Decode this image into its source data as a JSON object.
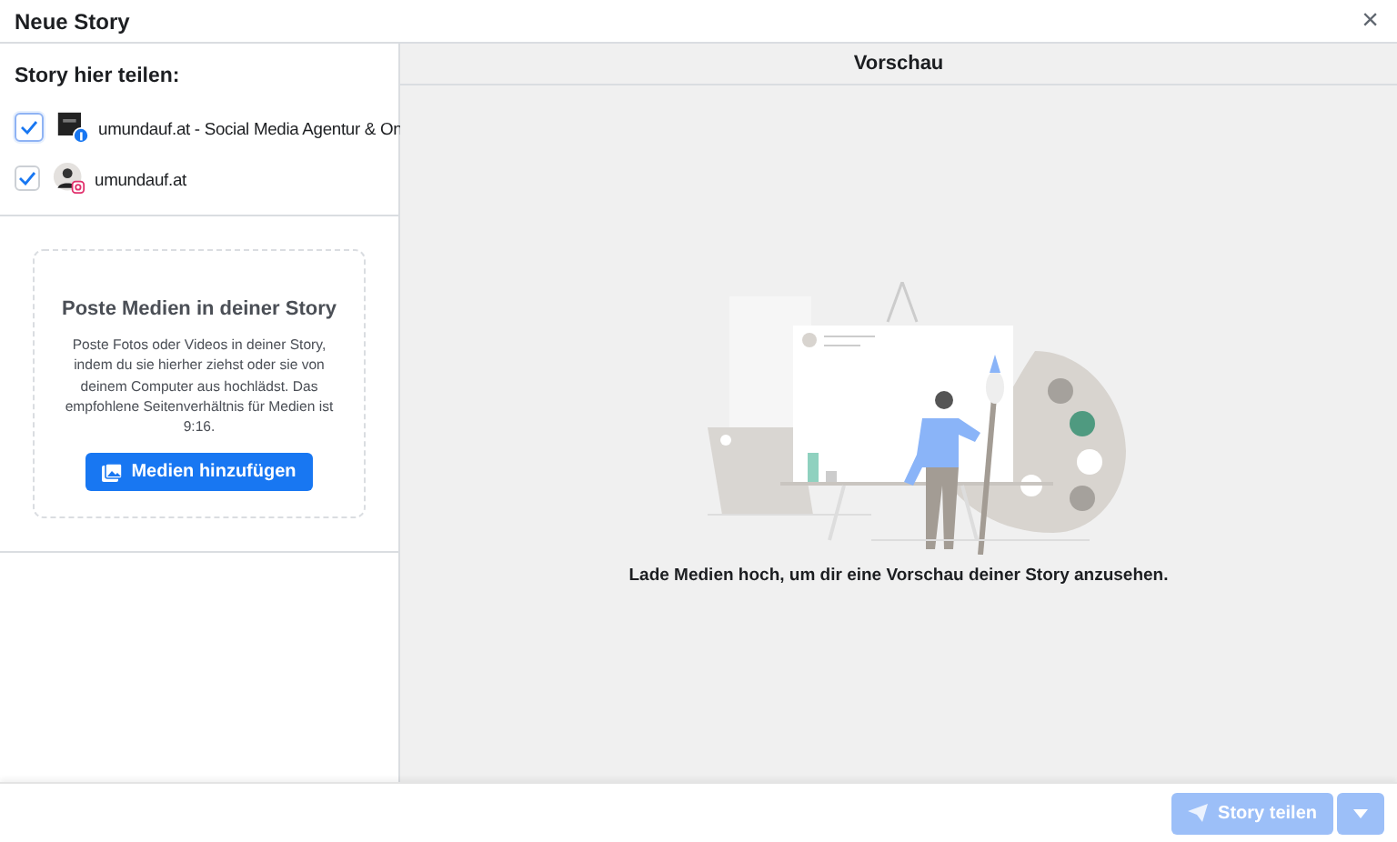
{
  "window": {
    "title": "Neue Story",
    "close": "×"
  },
  "share": {
    "heading": "Story hier teilen:",
    "accounts": [
      {
        "name": "umundauf.at - Social Media Agentur & On",
        "kind": "facebook",
        "checked": true
      },
      {
        "name": "umundauf.at",
        "kind": "instagram",
        "checked": true
      }
    ]
  },
  "dropzone": {
    "title": "Poste Medien in deiner Story",
    "text": "Poste Fotos oder Videos in deiner Story, indem du sie hierher ziehst oder sie von deinem Computer aus hochlädst. Das empfohlene Seitenverhältnis für Medien ist 9:16.",
    "button": "Medien hinzufügen"
  },
  "preview": {
    "title": "Vorschau",
    "caption": "Lade Medien hoch, um dir eine Vorschau deiner Story anzusehen."
  },
  "footer": {
    "share_button": {
      "label": "Story teilen",
      "disabled": true
    }
  }
}
